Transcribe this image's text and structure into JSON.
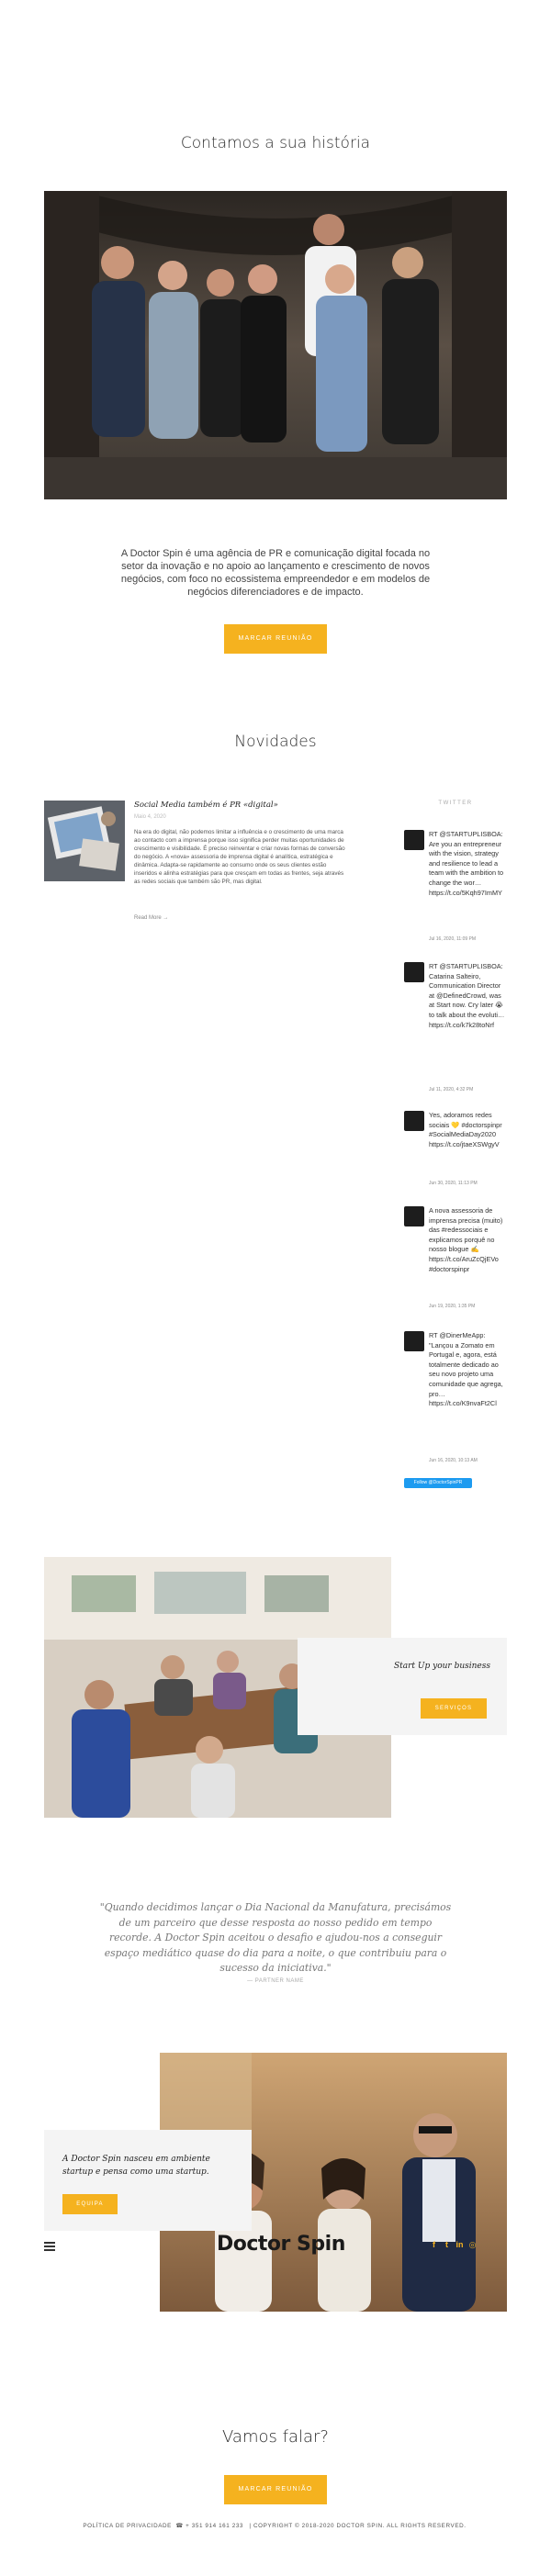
{
  "hero": {
    "title": "Contamos a sua história",
    "intro": "A Doctor Spin é uma agência de PR e comunicação digital focada no setor da inovação e no apoio ao lançamento e crescimento de novos negócios, com foco no ecossistema empreendedor e em modelos de negócios diferenciadores e de impacto.",
    "button": "MARCAR REUNIÃO"
  },
  "news": {
    "title": "Novidades",
    "post": {
      "title": "Social Media também é PR «digital»",
      "date": "Maio 4, 2020",
      "excerpt": "Na era do digital, não podemos limitar a influência e o crescimento de uma marca ao contacto com a imprensa porque isso significa perder muitas oportunidades de crescimento e visibilidade. É preciso reinventar e criar novas formas de conversão do negócio. A «nova» assessoria de imprensa digital é analítica, estratégica e dinâmica. Adapta-se rapidamente ao consumo onde os seus clientes estão inseridos e alinha estratégias para que cresçam em todas as frentes, seja através as redes sociais que também são PR, mas digital.",
      "read_more": "Read More →"
    },
    "twitter": {
      "label": "TWITTER",
      "follow": "Follow @DoctorSpinPR",
      "tweets": [
        {
          "text": "RT @STARTUPLISBOA: Are you an entrepreneur with the vision, strategy and resilience to lead a team with the ambition to change the wor… https://t.co/5Kqh97ImMY",
          "date": "Jul 16, 2020, 11:09 PM"
        },
        {
          "text": "RT @STARTUPLISBOA: Catarina Salteiro, Communication Director at @DefinedCrowd, was at Start now. Cry later 😭 to talk about the evoluti… https://t.co/k7k28toNrf",
          "date": "Jul 11, 2020, 4:32 PM"
        },
        {
          "text": "Yes, adoramos redes sociais 💛 #doctorspinpr #SocialMediaDay2020 https://t.co/jtaeXSWgyV",
          "date": "Jun 30, 2020, 11:13 PM"
        },
        {
          "text": "A nova assessoria de imprensa precisa (muito) das #redessociais e explicamos porquê no nosso blogue ✍️ https://t.co/AruZcQjEVo #doctorspinpr",
          "date": "Jun 19, 2020, 1:35 PM"
        },
        {
          "text": "RT @DinerMeApp: \"Lançou a Zomato em Portugal e, agora, está totalmente dedicado ao seu novo projeto uma comunidade que agrega, pro… https://t.co/K9nvaFt2Cl",
          "date": "Jun 16, 2020, 10:13 AM"
        }
      ]
    }
  },
  "startup": {
    "text": "Start Up your business",
    "button": "SERVIÇOS"
  },
  "quote": {
    "text": "\"Quando decidimos lançar o Dia Nacional da Manufatura, precisámos de um parceiro que desse resposta ao nosso pedido em tempo recorde. A Doctor Spin aceitou o desafio e ajudou-nos a conseguir espaço mediático quase do dia para a noite, o que contribuiu para o sucesso da iniciativa.\"",
    "source": "— PARTNER NAME"
  },
  "born": {
    "text": "A Doctor Spin nasceu em ambiente startup e pensa como uma startup.",
    "button": "EQUIPA"
  },
  "brand": {
    "logo": "Doctor Spin",
    "accent": "#f5b21f",
    "social_icons": [
      "facebook-icon",
      "twitter-icon",
      "linkedin-icon",
      "instagram-icon"
    ]
  },
  "contact": {
    "title": "Vamos falar?",
    "button": "MARCAR REUNIÃO"
  },
  "footer": {
    "privacy": "POLÍTICA DE PRIVACIDADE",
    "phone": "☎ + 351 914 161 233",
    "copyright": "| COPYRIGHT © 2018-2020 DOCTOR SPIN. ALL RIGHTS RESERVED."
  }
}
